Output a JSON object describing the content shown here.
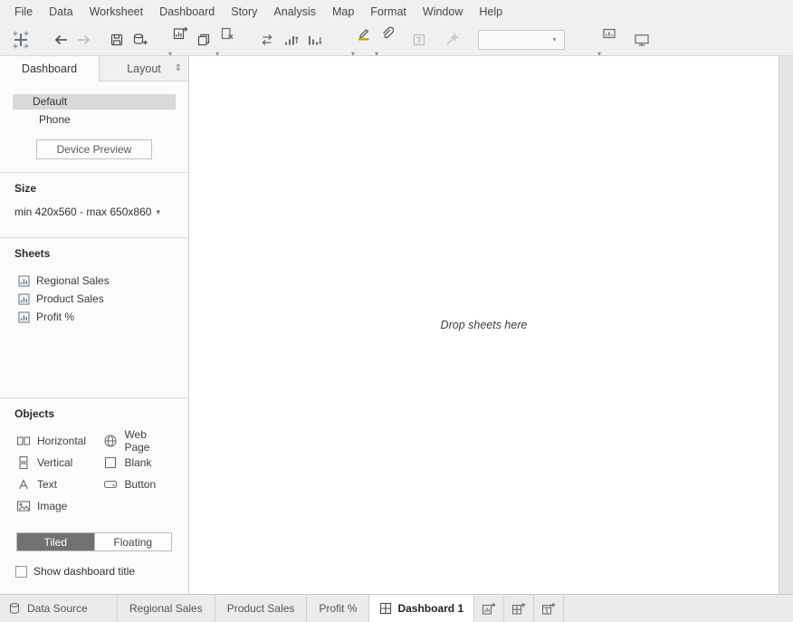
{
  "glyphs": {
    "caret_down": "▾",
    "spin_arrows": "⇕"
  },
  "menubar": {
    "items": [
      "File",
      "Data",
      "Worksheet",
      "Dashboard",
      "Story",
      "Analysis",
      "Map",
      "Format",
      "Window",
      "Help"
    ]
  },
  "toolbar": {
    "fit_value": ""
  },
  "sidebar": {
    "tabs": {
      "dashboard": "Dashboard",
      "layout": "Layout"
    },
    "device": {
      "default": "Default",
      "phone": "Phone",
      "preview_button": "Device Preview"
    },
    "size": {
      "heading": "Size",
      "value": "min 420x560 - max 650x860"
    },
    "sheets": {
      "heading": "Sheets",
      "items": [
        "Regional Sales",
        "Product Sales",
        "Profit %"
      ]
    },
    "objects": {
      "heading": "Objects",
      "items": [
        "Horizontal",
        "Vertical",
        "Text",
        "Image",
        "Web Page",
        "Blank",
        "Button"
      ]
    },
    "mode": {
      "tiled": "Tiled",
      "floating": "Floating",
      "selected": "Tiled"
    },
    "show_title": "Show dashboard title"
  },
  "canvas": {
    "placeholder": "Drop sheets here"
  },
  "statusbar": {
    "data_source": "Data Source",
    "tabs": [
      "Regional Sales",
      "Product Sales",
      "Profit %"
    ],
    "active_tab": "Dashboard 1"
  }
}
